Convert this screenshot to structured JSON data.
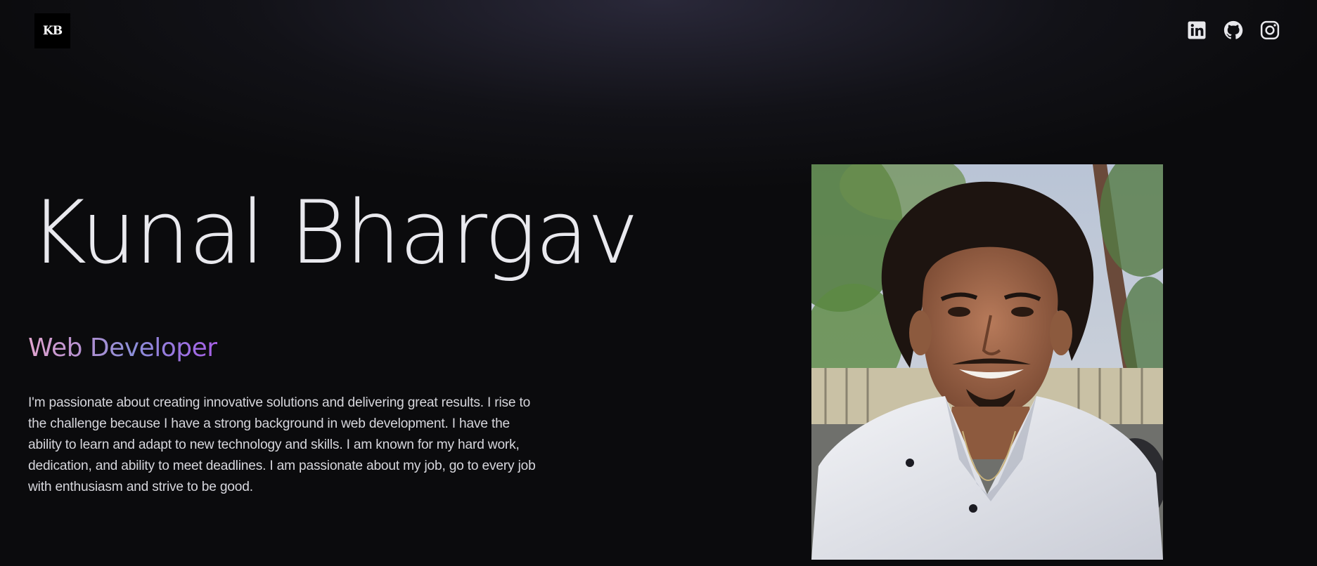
{
  "header": {
    "logo_text": "KB",
    "social_links": [
      {
        "name": "linkedin",
        "icon": "linkedin-icon"
      },
      {
        "name": "github",
        "icon": "github-icon"
      },
      {
        "name": "instagram",
        "icon": "instagram-icon"
      }
    ]
  },
  "hero": {
    "name": "Kunal Bhargav",
    "role": "Web Developer",
    "bio": "I'm passionate about creating innovative solutions and delivering great results. I rise to the challenge because I have a strong background in web development. I have the ability to learn and adapt to new technology and skills. I am known for my hard work, dedication, and ability to meet deadlines. I am passionate about my job, go to every job with enthusiasm and strive to be good."
  },
  "colors": {
    "background": "#0b0b0d",
    "text": "#e9e9ee",
    "role_gradient_start": "#e2a4cf",
    "role_gradient_end": "#a65fe6"
  }
}
